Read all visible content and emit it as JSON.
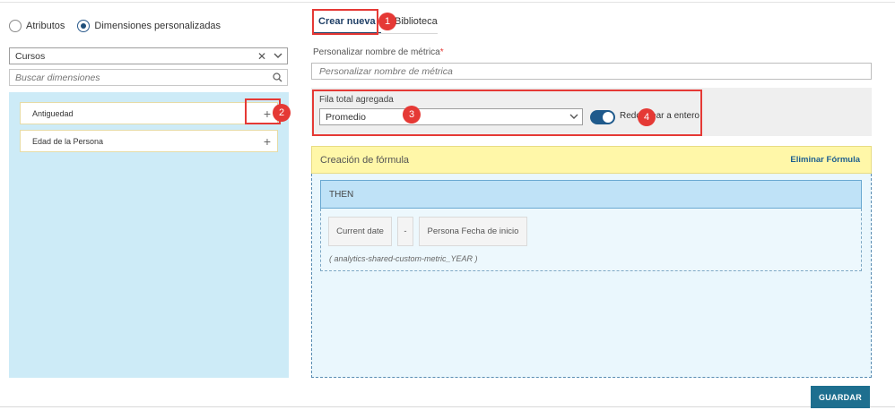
{
  "filter_mode": {
    "options": [
      {
        "label": "Atributos",
        "selected": false
      },
      {
        "label": "Dimensiones personalizadas",
        "selected": true
      }
    ]
  },
  "dimension_select": {
    "value": "Cursos"
  },
  "dimension_search": {
    "placeholder": "Buscar dimensiones"
  },
  "dimensions": [
    {
      "label": "Antiguedad"
    },
    {
      "label": "Edad de la Persona"
    }
  ],
  "tabs": [
    {
      "label": "Crear nueva",
      "active": true
    },
    {
      "label": "Biblioteca",
      "active": false
    }
  ],
  "metric_name": {
    "label": "Personalizar nombre de métrica",
    "required_mark": "*",
    "placeholder": "Personalizar nombre de métrica"
  },
  "aggregate": {
    "label": "Fila total agregada",
    "value": "Promedio",
    "toggle_label": "Redondear a entero",
    "toggle_on": true
  },
  "formula": {
    "title": "Creación de fórmula",
    "delete_label": "Eliminar Fórmula",
    "then_label": "THEN",
    "tokens": [
      "Current date",
      "-",
      "Persona Fecha de inicio"
    ],
    "note": "( analytics-shared-custom-metric_YEAR )"
  },
  "callouts": [
    "1",
    "2",
    "3",
    "4"
  ],
  "save_label": "GUARDAR",
  "colors": {
    "primary": "#1f5a8c",
    "callout": "#e53935",
    "panel_bg": "#cdebf7",
    "formula_header": "#fff7a8",
    "then_bar": "#bfe2f7",
    "save_button": "#1e6f8f"
  }
}
